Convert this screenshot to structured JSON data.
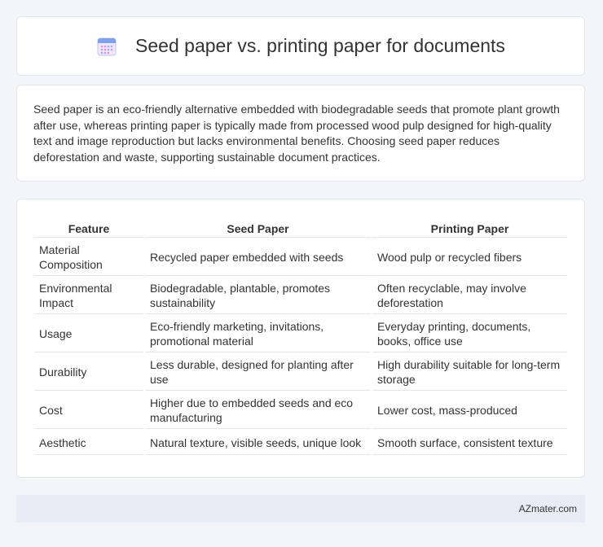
{
  "header": {
    "title": "Seed paper vs. printing paper for documents",
    "icon": "calendar-icon"
  },
  "intro": {
    "text": "Seed paper is an eco-friendly alternative embedded with biodegradable seeds that promote plant growth after use, whereas printing paper is typically made from processed wood pulp designed for high-quality text and image reproduction but lacks environmental benefits. Choosing seed paper reduces deforestation and waste, supporting sustainable document practices."
  },
  "table": {
    "headers": [
      "Feature",
      "Seed Paper",
      "Printing Paper"
    ],
    "rows": [
      [
        "Material Composition",
        "Recycled paper embedded with seeds",
        "Wood pulp or recycled fibers"
      ],
      [
        "Environmental Impact",
        "Biodegradable, plantable, promotes sustainability",
        "Often recyclable, may involve deforestation"
      ],
      [
        "Usage",
        "Eco-friendly marketing, invitations, promotional material",
        "Everyday printing, documents, books, office use"
      ],
      [
        "Durability",
        "Less durable, designed for planting after use",
        "High durability suitable for long-term storage"
      ],
      [
        "Cost",
        "Higher due to embedded seeds and eco manufacturing",
        "Lower cost, mass-produced"
      ],
      [
        "Aesthetic",
        "Natural texture, visible seeds, unique look",
        "Smooth surface, consistent texture"
      ]
    ]
  },
  "footer": {
    "brand": "AZmater.com"
  },
  "colors": {
    "background": "#f3f5f9",
    "card": "#ffffff",
    "footer": "#e8ecf5",
    "text": "#333333"
  }
}
